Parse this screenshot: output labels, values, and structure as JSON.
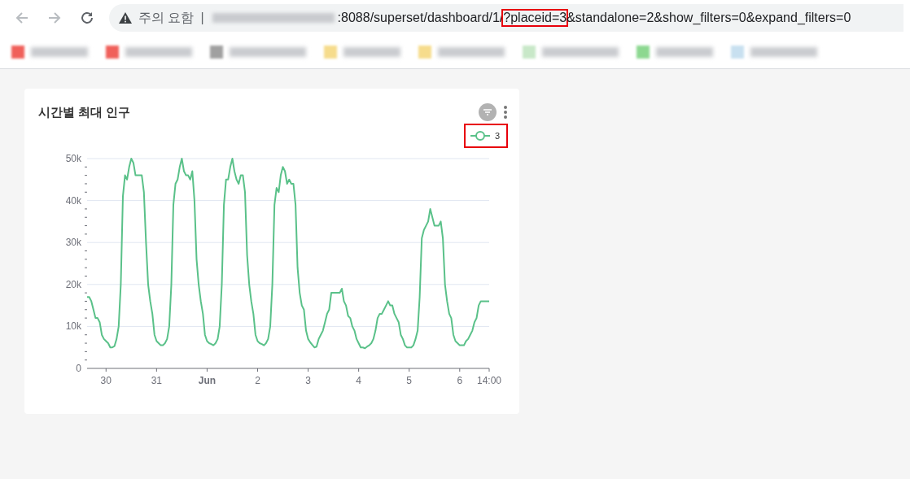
{
  "browser": {
    "security_label": "주의 요함",
    "separator": "|",
    "url_parts": [
      {
        "text": ":8088/superset/dashboard/1/",
        "highlighted": false
      },
      {
        "text": "?placeid=3",
        "highlighted": true
      },
      {
        "text": "&standalone=2&show_filters=0&expand_filters=0",
        "highlighted": false
      }
    ],
    "bookmarks": [
      {
        "color": "#f0605a"
      },
      {
        "color": "#f0605a"
      },
      {
        "color": "#a0a0a0"
      },
      {
        "color": "#f6dc8c"
      },
      {
        "color": "#f6dc8c"
      },
      {
        "color": "#c8e8c8"
      },
      {
        "color": "#8cd890"
      },
      {
        "color": "#c8e0f0"
      }
    ]
  },
  "chart_card": {
    "title": "시간별 최대 인구",
    "legend": {
      "highlighted": true
    },
    "chart_data": {
      "type": "line",
      "grid": true,
      "ylim": [
        0,
        50
      ],
      "categories": [
        null,
        null,
        null,
        null,
        null,
        null,
        null,
        null,
        null,
        "30",
        null,
        null,
        null,
        null,
        null,
        null,
        null,
        null,
        null,
        null,
        null,
        null,
        null,
        null,
        null,
        null,
        null,
        null,
        null,
        null,
        null,
        null,
        null,
        "31",
        null,
        null,
        null,
        null,
        null,
        null,
        null,
        null,
        null,
        null,
        null,
        null,
        null,
        null,
        null,
        null,
        null,
        null,
        null,
        null,
        null,
        null,
        null,
        "Jun",
        null,
        null,
        null,
        null,
        null,
        null,
        null,
        null,
        null,
        null,
        null,
        null,
        null,
        null,
        null,
        null,
        null,
        null,
        null,
        null,
        null,
        null,
        null,
        "2",
        null,
        null,
        null,
        null,
        null,
        null,
        null,
        null,
        null,
        null,
        null,
        null,
        null,
        null,
        null,
        null,
        null,
        null,
        null,
        null,
        null,
        null,
        null,
        "3",
        null,
        null,
        null,
        null,
        null,
        null,
        null,
        null,
        null,
        null,
        null,
        null,
        null,
        null,
        null,
        null,
        null,
        null,
        null,
        null,
        null,
        null,
        null,
        "4",
        null,
        null,
        null,
        null,
        null,
        null,
        null,
        null,
        null,
        null,
        null,
        null,
        null,
        null,
        null,
        null,
        null,
        null,
        null,
        null,
        null,
        null,
        null,
        "5",
        null,
        null,
        null,
        null,
        null,
        null,
        null,
        null,
        null,
        null,
        null,
        null,
        null,
        null,
        null,
        null,
        null,
        null,
        null,
        null,
        null,
        null,
        null,
        "6",
        null,
        null,
        null,
        null,
        null,
        null,
        null,
        null,
        null,
        null,
        null,
        null,
        null,
        "14:00"
      ],
      "yticks": [
        {
          "value": 0,
          "label": "0"
        },
        {
          "value": 10,
          "label": "10k"
        },
        {
          "value": 20,
          "label": "20k"
        },
        {
          "value": 30,
          "label": "30k"
        },
        {
          "value": 40,
          "label": "40k"
        },
        {
          "value": 50,
          "label": "50k"
        }
      ],
      "series": [
        {
          "name": "3",
          "color": "#5ac189",
          "values": [
            17,
            17,
            16,
            14,
            12,
            12,
            11,
            8,
            7,
            6.5,
            6,
            5,
            5,
            5.3,
            7,
            10,
            20,
            41,
            46,
            45,
            48,
            50,
            49,
            46,
            46,
            46,
            46,
            42,
            30,
            20,
            16,
            13,
            8,
            6.5,
            6,
            5.5,
            5.5,
            6,
            7,
            10,
            20,
            39,
            44,
            45,
            48,
            50,
            47,
            46,
            46,
            45,
            47,
            40,
            26,
            20,
            16,
            13,
            8,
            6.5,
            6,
            5.8,
            5.5,
            6,
            7,
            10,
            20,
            39,
            45,
            45,
            48,
            50,
            47,
            45,
            44,
            46,
            46,
            42,
            27,
            20,
            16,
            13,
            8,
            6.5,
            6,
            5.8,
            5.5,
            6,
            7,
            10,
            20,
            39,
            43,
            42,
            46,
            48,
            47,
            44,
            45,
            44,
            44,
            39,
            24,
            18,
            15,
            14,
            9,
            7,
            6.2,
            5.6,
            5,
            5.2,
            7,
            8,
            9,
            11,
            13,
            14,
            18,
            18,
            18,
            18,
            18,
            19,
            16,
            15,
            12.5,
            12,
            10,
            9,
            7,
            6,
            5,
            5,
            4.8,
            5.2,
            5.5,
            6,
            7,
            9,
            12,
            13,
            13,
            14,
            15,
            16,
            15,
            15,
            13,
            12,
            11,
            8,
            7,
            5.5,
            5,
            5,
            5,
            5.5,
            7,
            9,
            17,
            31,
            33,
            34,
            35,
            38,
            36,
            34,
            34,
            34,
            35,
            31,
            20,
            16,
            13,
            12,
            8,
            6.5,
            6,
            5.5,
            5.5,
            5.5,
            6.5,
            7,
            8,
            9,
            11,
            12,
            15,
            16,
            16,
            16,
            16,
            16
          ]
        }
      ]
    }
  }
}
